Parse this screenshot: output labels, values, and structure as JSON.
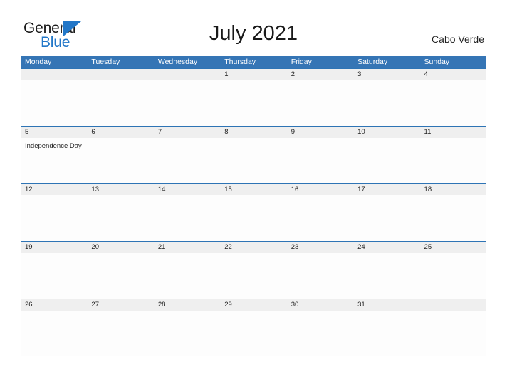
{
  "brand": {
    "name_part1": "General",
    "name_part2": "Blue",
    "accent_color": "#2277c8"
  },
  "header": {
    "title": "July 2021",
    "country": "Cabo Verde"
  },
  "calendar": {
    "header_bg": "#3575b5",
    "date_band_bg": "#efefef",
    "separator_color": "#2e74b5",
    "weekdays": [
      "Monday",
      "Tuesday",
      "Wednesday",
      "Thursday",
      "Friday",
      "Saturday",
      "Sunday"
    ],
    "weeks": [
      {
        "days": [
          {
            "date": "",
            "event": ""
          },
          {
            "date": "",
            "event": ""
          },
          {
            "date": "",
            "event": ""
          },
          {
            "date": "1",
            "event": ""
          },
          {
            "date": "2",
            "event": ""
          },
          {
            "date": "3",
            "event": ""
          },
          {
            "date": "4",
            "event": ""
          }
        ]
      },
      {
        "days": [
          {
            "date": "5",
            "event": "Independence Day"
          },
          {
            "date": "6",
            "event": ""
          },
          {
            "date": "7",
            "event": ""
          },
          {
            "date": "8",
            "event": ""
          },
          {
            "date": "9",
            "event": ""
          },
          {
            "date": "10",
            "event": ""
          },
          {
            "date": "11",
            "event": ""
          }
        ]
      },
      {
        "days": [
          {
            "date": "12",
            "event": ""
          },
          {
            "date": "13",
            "event": ""
          },
          {
            "date": "14",
            "event": ""
          },
          {
            "date": "15",
            "event": ""
          },
          {
            "date": "16",
            "event": ""
          },
          {
            "date": "17",
            "event": ""
          },
          {
            "date": "18",
            "event": ""
          }
        ]
      },
      {
        "days": [
          {
            "date": "19",
            "event": ""
          },
          {
            "date": "20",
            "event": ""
          },
          {
            "date": "21",
            "event": ""
          },
          {
            "date": "22",
            "event": ""
          },
          {
            "date": "23",
            "event": ""
          },
          {
            "date": "24",
            "event": ""
          },
          {
            "date": "25",
            "event": ""
          }
        ]
      },
      {
        "days": [
          {
            "date": "26",
            "event": ""
          },
          {
            "date": "27",
            "event": ""
          },
          {
            "date": "28",
            "event": ""
          },
          {
            "date": "29",
            "event": ""
          },
          {
            "date": "30",
            "event": ""
          },
          {
            "date": "31",
            "event": ""
          },
          {
            "date": "",
            "event": ""
          }
        ]
      }
    ]
  }
}
